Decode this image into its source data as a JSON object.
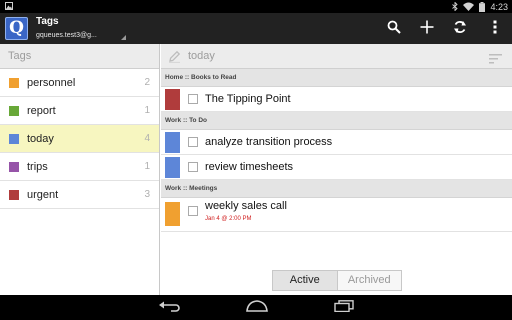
{
  "status_bar": {
    "time": "4:23"
  },
  "action_bar": {
    "app_icon_letter": "Q",
    "title": "Tags",
    "account": "gqueues.test3@g...",
    "actions": [
      "search-icon",
      "add-icon",
      "sync-icon",
      "overflow-menu-icon"
    ]
  },
  "left_pane": {
    "header": "Tags",
    "tags": [
      {
        "label": "personnel",
        "count": "2",
        "color": "#f0a030"
      },
      {
        "label": "report",
        "count": "1",
        "color": "#68a838"
      },
      {
        "label": "today",
        "count": "4",
        "color": "#5d86d8"
      },
      {
        "label": "trips",
        "count": "1",
        "color": "#9654a8"
      },
      {
        "label": "urgent",
        "count": "3",
        "color": "#b03c3c"
      }
    ]
  },
  "right_pane": {
    "title": "today",
    "sections": [
      {
        "label": "Home :: Books to Read",
        "tasks": [
          {
            "title": "The Tipping Point",
            "color": "#b03c3c"
          }
        ]
      },
      {
        "label": "Work :: To Do",
        "tasks": [
          {
            "title": "analyze transition process",
            "color": "#5d86d8"
          },
          {
            "title": "review timesheets",
            "color": "#5d86d8"
          }
        ]
      },
      {
        "label": "Work :: Meetings",
        "tasks": [
          {
            "title": "weekly sales call",
            "color": "#f0a030",
            "due": "Jan 4 @ 2:00 PM"
          }
        ]
      }
    ],
    "filter": {
      "active_label": "Active",
      "archived_label": "Archived",
      "selected": "Active"
    }
  },
  "colors": {
    "selected_row": "#f7f6c0",
    "due_text": "#d02020",
    "action_bar": "#222222"
  }
}
